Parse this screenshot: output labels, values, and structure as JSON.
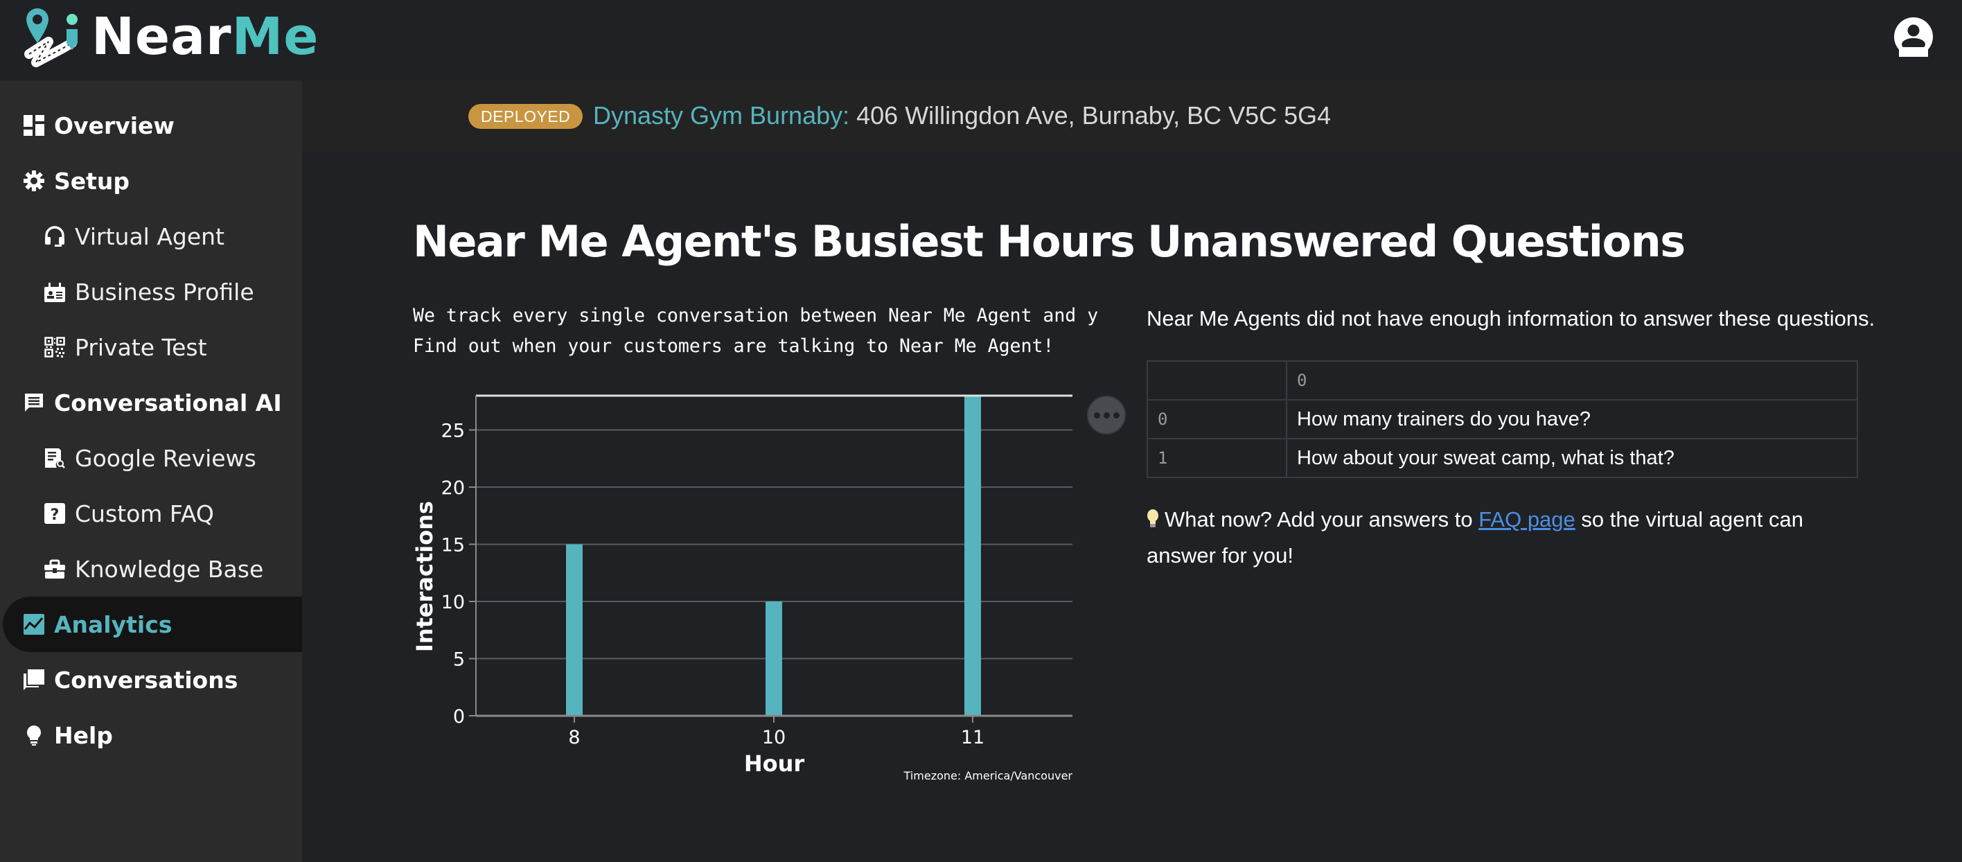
{
  "app": {
    "logo_text_near": "Near",
    "logo_text_me": "Me",
    "brand_colors": {
      "accent": "#56b4be",
      "logo_accent": "#4fc3c0",
      "badge": "#c99540",
      "link": "#4a90e2",
      "bar": "#56b4be"
    }
  },
  "header": {
    "account_icon": "account-circle-icon"
  },
  "sidebar": {
    "items": [
      {
        "label": "Overview",
        "icon": "dashboard-icon",
        "level": "top"
      },
      {
        "label": "Setup",
        "icon": "gear-icon",
        "level": "top"
      },
      {
        "label": "Virtual Agent",
        "icon": "headset-icon",
        "level": "sub"
      },
      {
        "label": "Business Profile",
        "icon": "id-card-icon",
        "level": "sub"
      },
      {
        "label": "Private Test",
        "icon": "qr-code-icon",
        "level": "sub"
      },
      {
        "label": "Conversational AI",
        "icon": "chat-icon",
        "level": "top"
      },
      {
        "label": "Google Reviews",
        "icon": "document-search-icon",
        "level": "sub"
      },
      {
        "label": "Custom FAQ",
        "icon": "question-icon",
        "level": "sub"
      },
      {
        "label": "Knowledge Base",
        "icon": "briefcase-icon",
        "level": "sub"
      },
      {
        "label": "Analytics",
        "icon": "chart-icon",
        "level": "top",
        "active": true
      },
      {
        "label": "Conversations",
        "icon": "forum-icon",
        "level": "top"
      },
      {
        "label": "Help",
        "icon": "lightbulb-icon",
        "level": "top"
      }
    ]
  },
  "banner": {
    "status": "DEPLOYED",
    "business_name": "Dynasty Gym Burnaby:",
    "address": " 406 Willingdon Ave, Burnaby, BC V5C 5G4"
  },
  "busiest": {
    "title": "Near Me Agent's Busiest Hours",
    "line1": "We track every single conversation between Near Me Agent and y",
    "line2": "Find out when your customers are talking to Near Me Agent!"
  },
  "chart_data": {
    "type": "bar",
    "title": "",
    "categories": [
      "8",
      "10",
      "11"
    ],
    "values": [
      15,
      10,
      28
    ],
    "xlabel": "Hour",
    "ylabel": "Interactions",
    "ylim": [
      0,
      28
    ],
    "yticks": [
      0,
      5,
      10,
      15,
      20,
      25
    ],
    "grid": true,
    "annotation": "Timezone: America/Vancouver",
    "menu_icon": "more-horizontal-icon"
  },
  "unanswered": {
    "title": "Unanswered Questions",
    "description": "Near Me Agents did not have enough information to answer these questions.",
    "table": {
      "columns": [
        "",
        "0"
      ],
      "rows": [
        {
          "index": "0",
          "question": "How many trainers do you have?"
        },
        {
          "index": "1",
          "question": "How about your sweat camp, what is that?"
        }
      ]
    },
    "tip_prefix": "What now? Add your answers to ",
    "tip_link": "FAQ page",
    "tip_suffix": " so the virtual agent can answer for you!"
  }
}
